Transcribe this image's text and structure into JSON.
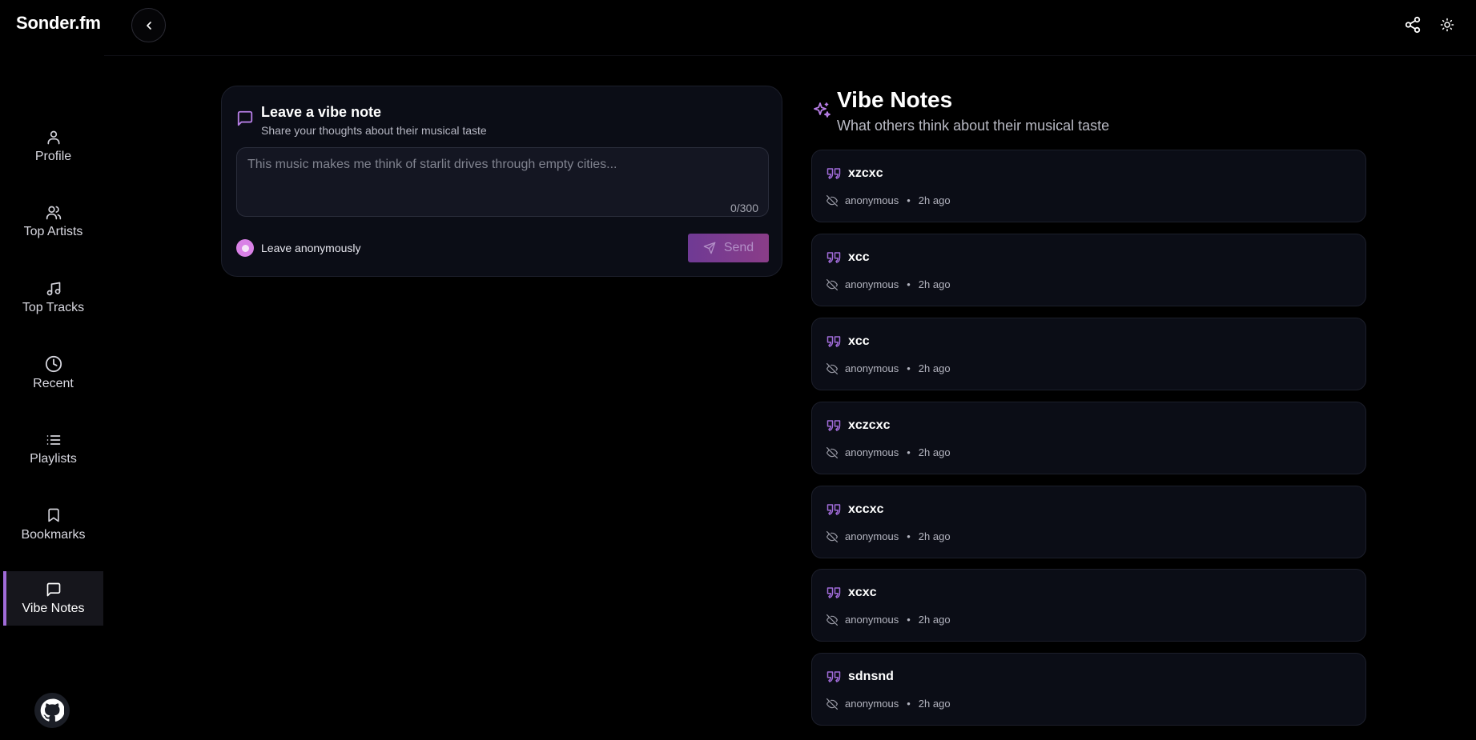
{
  "app": {
    "brand": "Sonder.fm"
  },
  "sidebar": {
    "items": [
      {
        "label": "Profile",
        "icon": "user-icon"
      },
      {
        "label": "Top Artists",
        "icon": "users-icon"
      },
      {
        "label": "Top Tracks",
        "icon": "music-note-icon"
      },
      {
        "label": "Recent",
        "icon": "clock-icon"
      },
      {
        "label": "Playlists",
        "icon": "list-icon"
      },
      {
        "label": "Bookmarks",
        "icon": "bookmark-icon"
      },
      {
        "label": "Vibe Notes",
        "icon": "message-square-icon",
        "active": true
      }
    ]
  },
  "compose": {
    "title": "Leave a vibe note",
    "subtitle": "Share your thoughts about their musical taste",
    "placeholder": "This music makes me think of starlit drives through empty cities...",
    "value": "",
    "counter": "0/300",
    "anonymous_label": "Leave anonymously",
    "anonymous_checked": true,
    "send_label": "Send"
  },
  "notes": {
    "title": "Vibe Notes",
    "subtitle": "What others think about their musical taste",
    "items": [
      {
        "text": "xzcxc",
        "author": "anonymous",
        "time": "2h ago"
      },
      {
        "text": "xcc",
        "author": "anonymous",
        "time": "2h ago"
      },
      {
        "text": "xcc",
        "author": "anonymous",
        "time": "2h ago"
      },
      {
        "text": "xczcxc",
        "author": "anonymous",
        "time": "2h ago"
      },
      {
        "text": "xccxc",
        "author": "anonymous",
        "time": "2h ago"
      },
      {
        "text": "xcxc",
        "author": "anonymous",
        "time": "2h ago"
      },
      {
        "text": "sdnsnd",
        "author": "anonymous",
        "time": "2h ago"
      }
    ]
  },
  "colors": {
    "accent": "#a06bd8",
    "card_bg": "#0b0d16",
    "page_bg": "#000000",
    "toggle": "#d981e6"
  }
}
